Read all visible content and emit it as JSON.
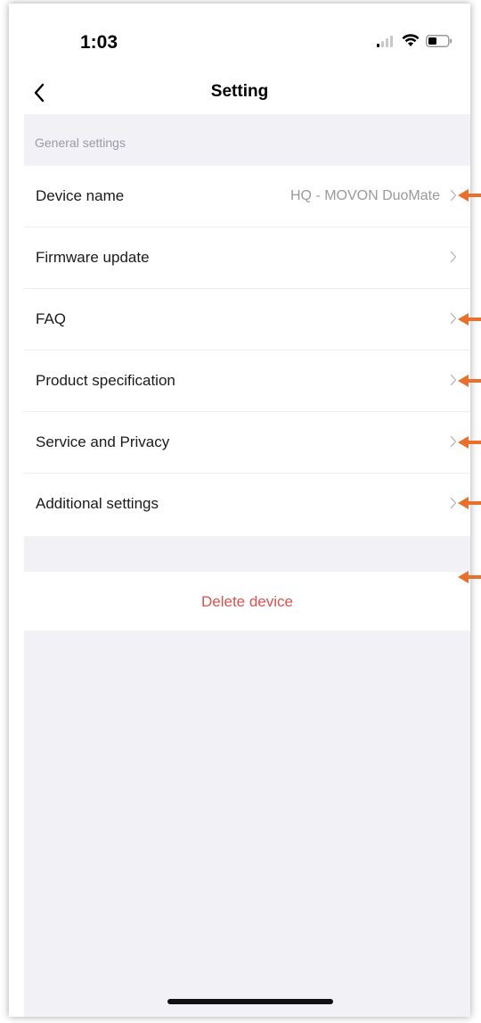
{
  "status_bar": {
    "time": "1:03",
    "signal_icon": "cellular-signal-icon",
    "wifi_icon": "wifi-icon",
    "battery_icon": "battery-icon"
  },
  "nav": {
    "title": "Setting",
    "back_icon": "chevron-left-icon"
  },
  "section": {
    "header": "General settings"
  },
  "settings": [
    {
      "label": "Device name",
      "value": "HQ  - MOVON DuoMate"
    },
    {
      "label": "Firmware update",
      "value": ""
    },
    {
      "label": "FAQ",
      "value": ""
    },
    {
      "label": "Product specification",
      "value": ""
    },
    {
      "label": "Service and Privacy",
      "value": ""
    },
    {
      "label": "Additional settings",
      "value": ""
    }
  ],
  "delete_device": {
    "label": "Delete device",
    "color": "#d9534f"
  },
  "colors": {
    "section_background": "#f1f1f6",
    "annotation_arrow": "#e8702a"
  }
}
